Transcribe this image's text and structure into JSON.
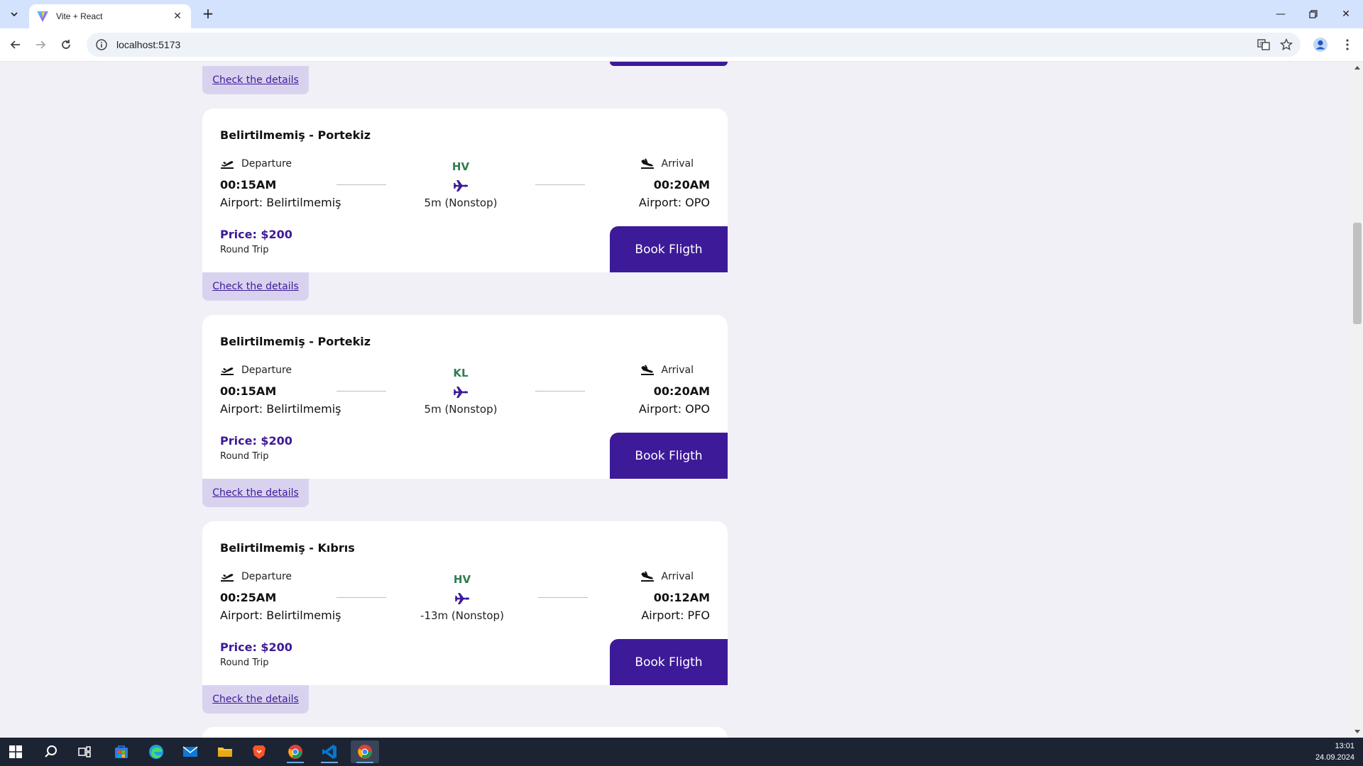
{
  "browser": {
    "tab_title": "Vite + React",
    "url": "localhost:5173"
  },
  "top_partial": {
    "details_label": "Check the details"
  },
  "flights": [
    {
      "route": "Belirtilmemiş - Portekiz",
      "departure_label": "Departure",
      "departure_time": "00:15AM",
      "departure_airport": "Airport: Belirtilmemiş",
      "airline": "HV",
      "duration": "5m (Nonstop)",
      "arrival_label": "Arrival",
      "arrival_time": "00:20AM",
      "arrival_airport": "Airport: OPO",
      "price": "Price: $200",
      "trip_type": "Round Trip",
      "book_label": "Book Fligth",
      "details_label": "Check the details"
    },
    {
      "route": "Belirtilmemiş - Portekiz",
      "departure_label": "Departure",
      "departure_time": "00:15AM",
      "departure_airport": "Airport: Belirtilmemiş",
      "airline": "KL",
      "duration": "5m (Nonstop)",
      "arrival_label": "Arrival",
      "arrival_time": "00:20AM",
      "arrival_airport": "Airport: OPO",
      "price": "Price: $200",
      "trip_type": "Round Trip",
      "book_label": "Book Fligth",
      "details_label": "Check the details"
    },
    {
      "route": "Belirtilmemiş - Kıbrıs",
      "departure_label": "Departure",
      "departure_time": "00:25AM",
      "departure_airport": "Airport: Belirtilmemiş",
      "airline": "HV",
      "duration": "-13m (Nonstop)",
      "arrival_label": "Arrival",
      "arrival_time": "00:12AM",
      "arrival_airport": "Airport: PFO",
      "price": "Price: $200",
      "trip_type": "Round Trip",
      "book_label": "Book Fligth",
      "details_label": "Check the details"
    }
  ],
  "taskbar": {
    "time": "13:01",
    "date": "24.09.2024",
    "apps": [
      "start-icon",
      "search-icon",
      "task-view-icon",
      "store-icon",
      "edge-icon",
      "mail-icon",
      "file-explorer-icon",
      "brave-icon",
      "chrome-icon",
      "vscode-icon",
      "chrome-icon"
    ]
  },
  "colors": {
    "accent": "#3d1a98",
    "airline_code": "#2e7d4f",
    "page_bg": "#f1f0f6",
    "details_bg": "#d9d2ef"
  }
}
